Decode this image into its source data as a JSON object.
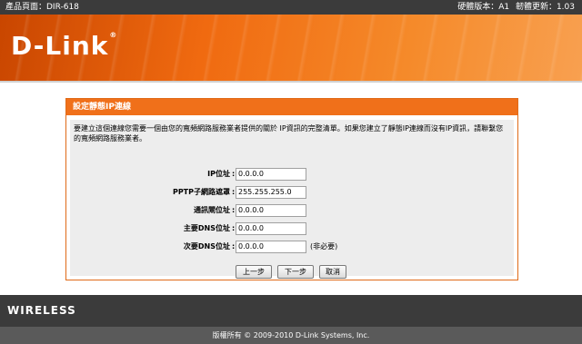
{
  "topbar": {
    "product_page": "產品頁面：DIR-618",
    "hw_version": "硬體版本：A1",
    "fw_version": "韌體更新：1.03"
  },
  "banner": {
    "logo": "D-Link",
    "logo_mark": "®"
  },
  "panel": {
    "title": "設定靜態IP連線",
    "intro": "要建立這個連線您需要一個由您的寬頻網路服務業者提供的關於 IP資訊的完整清單。如果您建立了靜態IP連線而沒有IP資訊，請聯繫您的寬頻網路服務業者。",
    "fields": [
      {
        "label": "IP位址",
        "value": "0.0.0.0",
        "note": ""
      },
      {
        "label": "PPTP子網路遮罩",
        "value": "255.255.255.0",
        "note": ""
      },
      {
        "label": "通訊閘位址",
        "value": "0.0.0.0",
        "note": ""
      },
      {
        "label": "主要DNS位址",
        "value": "0.0.0.0",
        "note": ""
      },
      {
        "label": "次要DNS位址",
        "value": "0.0.0.0",
        "note": "(非必要)"
      }
    ],
    "buttons": {
      "prev": "上一步",
      "next": "下一步",
      "cancel": "取消"
    }
  },
  "footer": {
    "brand": "WIRELESS",
    "copyright": "版權所有 © 2009-2010 D-Link Systems, Inc."
  },
  "colors": {
    "accent": "#f0701a",
    "dark_bar": "#3b3b3b"
  }
}
